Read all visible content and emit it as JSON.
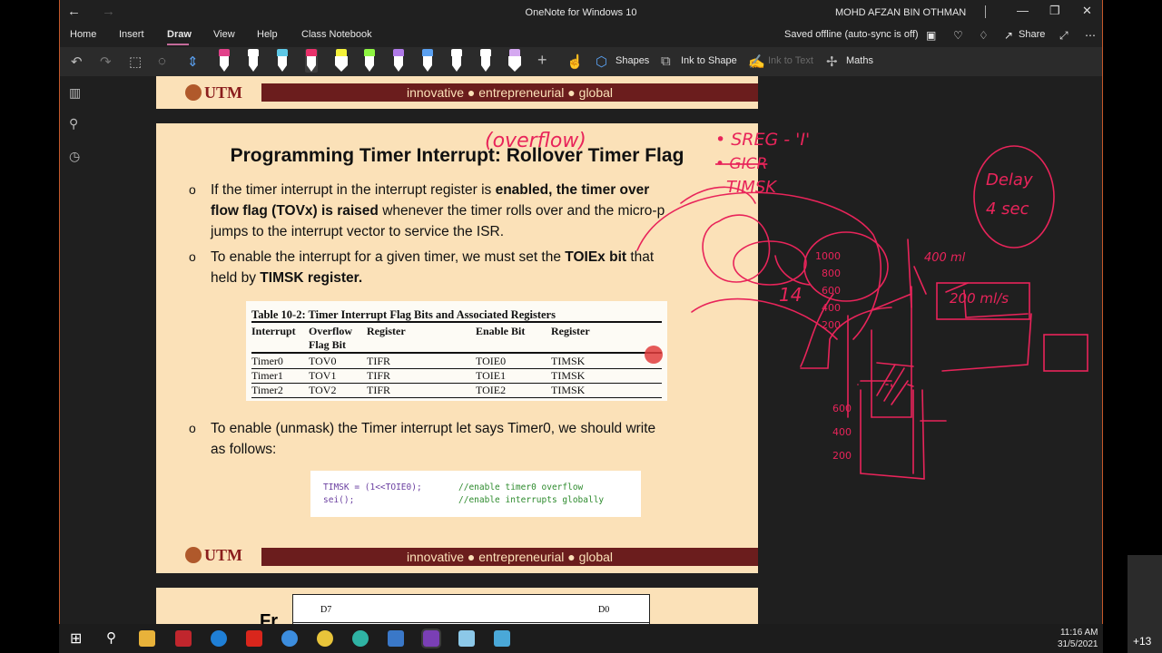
{
  "window": {
    "title": "OneNote for Windows 10",
    "user": "MOHD AFZAN BIN OTHMAN"
  },
  "menu": {
    "tabs": [
      "Home",
      "Insert",
      "Draw",
      "View",
      "Help",
      "Class Notebook"
    ],
    "active_tab": "Draw",
    "sync_status": "Saved offline (auto-sync is off)",
    "share_label": "Share"
  },
  "ribbon": {
    "shapes_label": "Shapes",
    "ink_to_shape_label": "Ink to Shape",
    "ink_to_text_label": "Ink to Text",
    "maths_label": "Maths",
    "pen_colors": [
      "#e2418a",
      "#ffffff",
      "#5ec8e6",
      "#e8306a",
      "#f5f23a",
      "#8ef542",
      "#b07ae8",
      "#5aa0f0",
      "#ffffff",
      "#ffffff",
      "#d4a8f0"
    ]
  },
  "slide": {
    "brand_logo": "UTM",
    "brand_tagline": "innovative ● entrepreneurial ● global",
    "heading": "Programming Timer Interrupt: Rollover Timer Flag",
    "bullet_marker": "o",
    "bullet1_a": "If the timer interrupt in the interrupt register is ",
    "bullet1_b": "enabled, the timer over",
    "bullet1_line2_b": "flow flag (TOVx) is raised",
    "bullet1_line2_c": " whenever the timer rolls over and the micro-p",
    "bullet1_line3": "jumps to the interrupt vector to service the ISR.",
    "bullet2_a": "To enable the interrupt for a given timer, we must set the ",
    "bullet2_b": "TOIEx bit",
    "bullet2_c": " that",
    "bullet2_line2_a": "held by ",
    "bullet2_line2_b": "TIMSK register.",
    "table": {
      "caption": "Table 10-2: Timer Interrupt Flag Bits and Associated Registers",
      "headers": [
        "Interrupt",
        "Overflow",
        "Flag Bit",
        "Register",
        "Enable Bit",
        "Register"
      ],
      "rows": [
        [
          "Timer0",
          "TOV0",
          "TIFR",
          "TOIE0",
          "TIMSK"
        ],
        [
          "Timer1",
          "TOV1",
          "TIFR",
          "TOIE1",
          "TIMSK"
        ],
        [
          "Timer2",
          "TOV2",
          "TIFR",
          "TOIE2",
          "TIMSK"
        ]
      ]
    },
    "bullet3_line1": "To enable (unmask) the Timer interrupt let says Timer0, we should write",
    "bullet3_line2": "as follows:",
    "code": {
      "line1": "TIMSK = (1<<TOIE0);",
      "comment1": "//enable timer0 overflow",
      "line2": "sei();",
      "comment2": "//enable interrupts globally"
    },
    "next_slide_title_fragment": "Fr",
    "next_slide_labels": [
      "D7",
      "D0"
    ]
  },
  "ink": {
    "overflow_note": "(overflow)",
    "sreg_note": "• SREG - 'I'",
    "gicr_note": "• GICR",
    "timsk_note": "TIMSK",
    "delay_note_1": "Delay",
    "delay_note_2": "4 sec",
    "rate_note": "400 ml",
    "rate2_note": "200 ml/s",
    "scale1": [
      "1000",
      "800",
      "600",
      "400",
      "200"
    ],
    "scale2": [
      "600",
      "400",
      "200"
    ],
    "side_label": "14"
  },
  "taskbar": {
    "time": "11:16 AM",
    "date": "31/5/2021",
    "overflow_badge": "+13"
  }
}
